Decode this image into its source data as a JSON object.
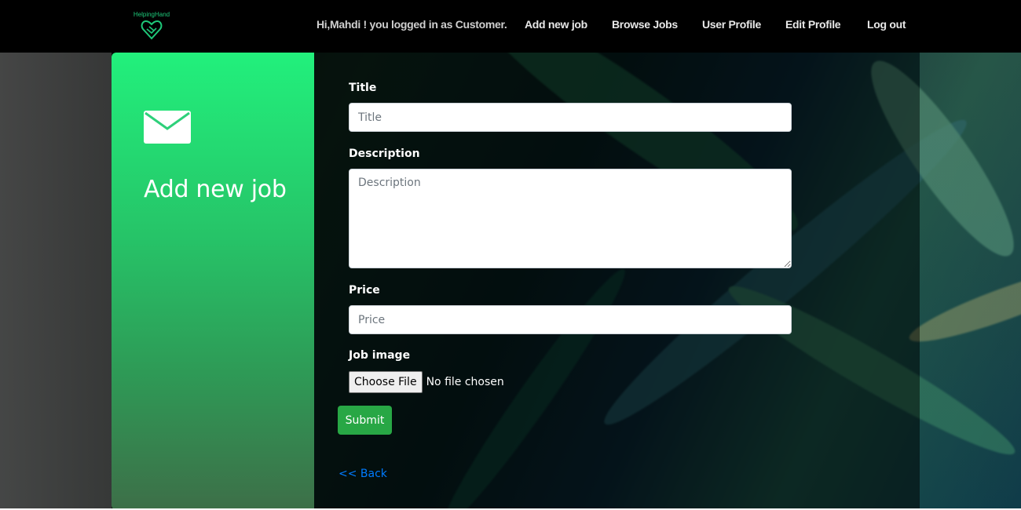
{
  "brand": {
    "logo_text": "HelpingHand",
    "accent": "#1ec97a"
  },
  "navbar": {
    "greeting": "Hi,Mahdi ! you logged in as Customer.",
    "links": [
      {
        "label": "Add new job"
      },
      {
        "label": "Browse Jobs"
      },
      {
        "label": "User Profile"
      },
      {
        "label": "Edit Profile"
      },
      {
        "label": "Log out"
      }
    ]
  },
  "panel": {
    "icon": "envelope-icon",
    "title": "Add new job"
  },
  "form": {
    "title": {
      "label": "Title",
      "placeholder": "Title"
    },
    "description": {
      "label": "Description",
      "placeholder": "Description"
    },
    "price": {
      "label": "Price",
      "placeholder": "Price"
    },
    "image": {
      "label": "Job image",
      "button": "Choose File",
      "status": "No file chosen"
    },
    "submit_label": "Submit",
    "back_label": "<< Back"
  },
  "colors": {
    "submit": "#28a745",
    "link": "#007bff",
    "panel_top": "#22f07c"
  }
}
